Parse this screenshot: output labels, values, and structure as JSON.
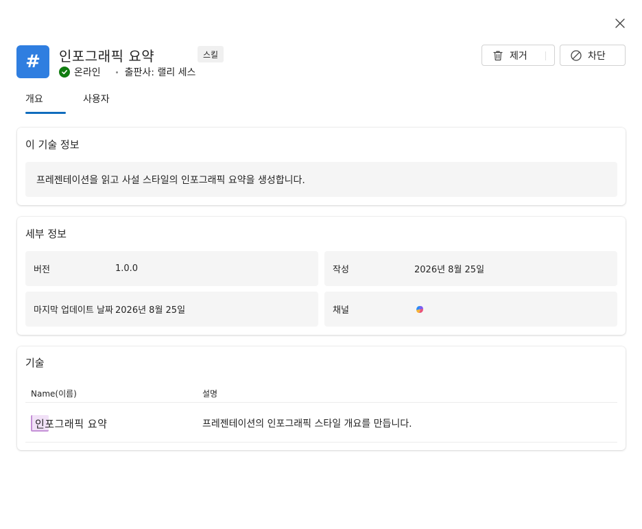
{
  "header": {
    "icon_symbol": "#",
    "icon_color": "#2f7ee0",
    "title": "인포그래픽 요약",
    "badge": "스킬",
    "status": "온라인",
    "status_color": "#107c10",
    "publisher": "출판사: 랠리 세스"
  },
  "actions": {
    "remove_label": "제거",
    "block_label": "차단"
  },
  "tabs": [
    {
      "label": "개요",
      "selected": true
    },
    {
      "label": "사용자",
      "selected": false
    }
  ],
  "about": {
    "title": "이 기술 정보",
    "description": "프레젠테이션을 읽고 사설 스타일의 인포그래픽 요약을 생성합니다."
  },
  "details": {
    "title": "세부 정보",
    "version_label": "버전",
    "version_value": "1.0.0",
    "author_label": "작성",
    "author_value": "2026년 8월 25일",
    "updated_label": "마지막 업데이트 날짜",
    "updated_value": "2026년 8월 25일",
    "channel_label": "채널",
    "channel_icon": "copilot-icon"
  },
  "skills": {
    "title": "기술",
    "col_name": "Name(이름)",
    "col_desc": "설명",
    "rows": [
      {
        "name": "인포그래픽 요약",
        "description": "프레젠테이션의 인포그래픽 스타일 개요를 만듭니다."
      }
    ]
  }
}
